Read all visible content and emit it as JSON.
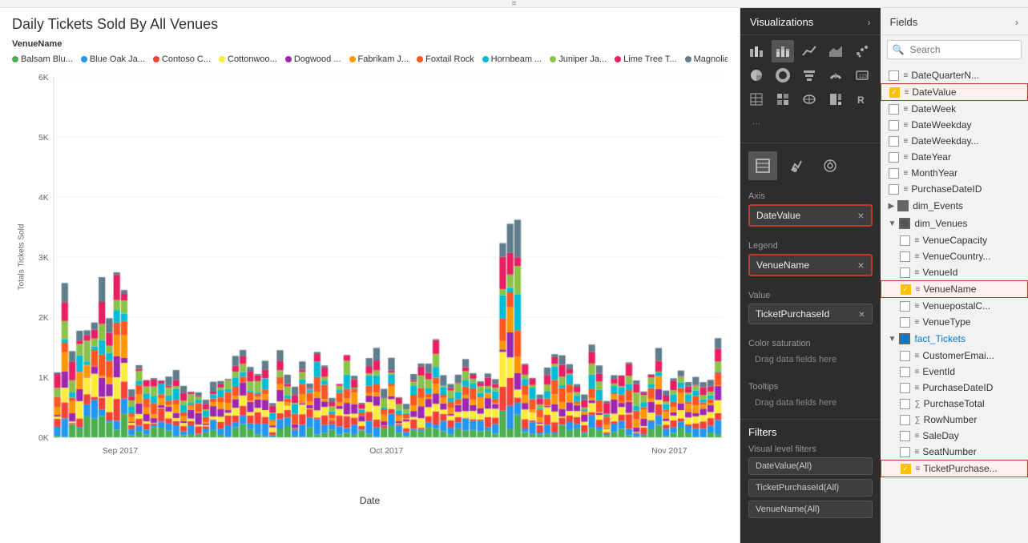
{
  "topbar": {
    "icon": "≡"
  },
  "chart": {
    "title": "Daily Tickets Sold By All Venues",
    "legend_label": "VenueName",
    "y_axis_label": "Totals Tickets Sold",
    "x_axis_label": "Date",
    "x_ticks": [
      "Sep 2017",
      "Oct 2017",
      "Nov 2017"
    ],
    "y_ticks": [
      "0K",
      "1K",
      "2K",
      "3K",
      "4K",
      "5K",
      "6K"
    ],
    "legend_items": [
      {
        "label": "Balsam Blu...",
        "color": "#4CAF50"
      },
      {
        "label": "Blue Oak Ja...",
        "color": "#2196F3"
      },
      {
        "label": "Contoso C...",
        "color": "#F44336"
      },
      {
        "label": "Cottonwoo...",
        "color": "#FFEB3B"
      },
      {
        "label": "Dogwood ...",
        "color": "#9C27B0"
      },
      {
        "label": "Fabrikam J...",
        "color": "#FF9800"
      },
      {
        "label": "Foxtail Rock",
        "color": "#FF5722"
      },
      {
        "label": "Hornbeam ...",
        "color": "#00BCD4"
      },
      {
        "label": "Juniper Ja...",
        "color": "#8BC34A"
      },
      {
        "label": "Lime Tree T...",
        "color": "#E91E63"
      },
      {
        "label": "Magnolia ...",
        "color": "#607D8B"
      }
    ]
  },
  "viz_panel": {
    "title": "Visualizations",
    "arrow": "›",
    "icons": [
      {
        "name": "bar-chart-icon",
        "symbol": "▦",
        "active": true
      },
      {
        "name": "stacked-bar-icon",
        "symbol": "▥"
      },
      {
        "name": "line-chart-icon",
        "symbol": "📈"
      },
      {
        "name": "area-chart-icon",
        "symbol": "▲"
      },
      {
        "name": "scatter-icon",
        "symbol": "✦"
      },
      {
        "name": "pie-chart-icon",
        "symbol": "◕"
      },
      {
        "name": "donut-icon",
        "symbol": "○"
      },
      {
        "name": "funnel-icon",
        "symbol": "⬡"
      },
      {
        "name": "gauge-icon",
        "symbol": "◑"
      },
      {
        "name": "card-icon",
        "symbol": "▢"
      },
      {
        "name": "table-icon",
        "symbol": "⊞"
      },
      {
        "name": "matrix-icon",
        "symbol": "⊟"
      },
      {
        "name": "map-icon",
        "symbol": "◉"
      },
      {
        "name": "treemap-icon",
        "symbol": "⊠"
      },
      {
        "name": "r-visual-icon",
        "symbol": "R"
      },
      {
        "name": "more-icon",
        "symbol": "···"
      }
    ],
    "pane_icons": [
      {
        "name": "fields-pane-icon",
        "symbol": "⊞"
      },
      {
        "name": "format-pane-icon",
        "symbol": "🖌"
      },
      {
        "name": "analytics-pane-icon",
        "symbol": "🔍"
      }
    ],
    "axis_label": "Axis",
    "axis_value": "DateValue",
    "legend_label": "Legend",
    "legend_value": "VenueName",
    "value_label": "Value",
    "value_value": "TicketPurchaseId",
    "color_saturation_label": "Color saturation",
    "color_saturation_placeholder": "Drag data fields here",
    "tooltips_label": "Tooltips",
    "tooltips_placeholder": "Drag data fields here",
    "filters_title": "Filters",
    "visual_level_label": "Visual level filters",
    "filter_items": [
      {
        "label": "DateValue(All)"
      },
      {
        "label": "TicketPurchaseId(All)"
      },
      {
        "label": "VenueName(All)"
      }
    ]
  },
  "fields_panel": {
    "title": "Fields",
    "close_symbol": "›",
    "search_placeholder": "Search",
    "fields": [
      {
        "name": "DateQuarterN...",
        "type": "text",
        "checked": false,
        "sigma": false,
        "indent": false
      },
      {
        "name": "DateValue",
        "type": "text",
        "checked": true,
        "sigma": false,
        "indent": false,
        "highlight": true,
        "checkbox_color": "yellow"
      },
      {
        "name": "DateWeek",
        "type": "text",
        "checked": false,
        "sigma": false,
        "indent": false
      },
      {
        "name": "DateWeekday",
        "type": "text",
        "checked": false,
        "sigma": false,
        "indent": false
      },
      {
        "name": "DateWeekday...",
        "type": "text",
        "checked": false,
        "sigma": false,
        "indent": false
      },
      {
        "name": "DateYear",
        "type": "text",
        "checked": false,
        "sigma": false,
        "indent": false
      },
      {
        "name": "MonthYear",
        "type": "text",
        "checked": false,
        "sigma": false,
        "indent": false
      },
      {
        "name": "PurchaseDateID",
        "type": "text",
        "checked": false,
        "sigma": false,
        "indent": false
      }
    ],
    "groups": [
      {
        "name": "dim_Events",
        "expanded": false,
        "items": []
      },
      {
        "name": "dim_Venues",
        "expanded": true,
        "items": [
          {
            "name": "VenueCapacity",
            "checked": false,
            "sigma": false
          },
          {
            "name": "VenueCountry...",
            "checked": false,
            "sigma": false
          },
          {
            "name": "VenueId",
            "checked": false,
            "sigma": false
          },
          {
            "name": "VenueName",
            "checked": true,
            "sigma": false,
            "highlight": true,
            "checkbox_color": "yellow"
          },
          {
            "name": "VenuepostalC...",
            "checked": false,
            "sigma": false
          },
          {
            "name": "VenueType",
            "checked": false,
            "sigma": false
          }
        ]
      },
      {
        "name": "fact_Tickets",
        "expanded": true,
        "blue": true,
        "items": [
          {
            "name": "CustomerEmai...",
            "checked": false,
            "sigma": false
          },
          {
            "name": "EventId",
            "checked": false,
            "sigma": false
          },
          {
            "name": "PurchaseDateID",
            "checked": false,
            "sigma": false
          },
          {
            "name": "PurchaseTotal",
            "checked": false,
            "sigma": true
          },
          {
            "name": "RowNumber",
            "checked": false,
            "sigma": true
          },
          {
            "name": "SaleDay",
            "checked": false,
            "sigma": false
          },
          {
            "name": "SeatNumber",
            "checked": false,
            "sigma": false
          },
          {
            "name": "TicketPurchase...",
            "checked": true,
            "sigma": false,
            "highlight": true,
            "checkbox_color": "yellow"
          }
        ]
      }
    ]
  }
}
